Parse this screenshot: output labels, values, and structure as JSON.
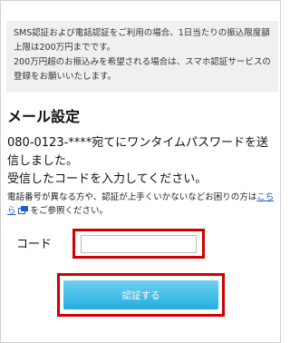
{
  "notice": {
    "line1": "SMS認証および電話認証をご利用の場合、1日当たりの振込限度額上限は200万円までです。",
    "line2": "200万円超のお振込みを希望される場合は、スマホ認証サービスの登録をお願いいたします。"
  },
  "heading": "メール設定",
  "message": {
    "line1": "080-0123-****宛てにワンタイムパスワードを送信しました。",
    "line2": "受信したコードを入力してください。"
  },
  "sub": {
    "prefix": "電話番号が異なる方や、認証が上手くいかないなどお困りの方は",
    "link": "こちら",
    "suffix": "をご参照ください。"
  },
  "code": {
    "label": "コード",
    "value": "",
    "placeholder": ""
  },
  "submit_label": "認証する",
  "colors": {
    "highlight": "#d10000",
    "button": "#22aee2",
    "link": "#1a5fc8"
  },
  "icons": {
    "link_external": "external-link-icon"
  }
}
